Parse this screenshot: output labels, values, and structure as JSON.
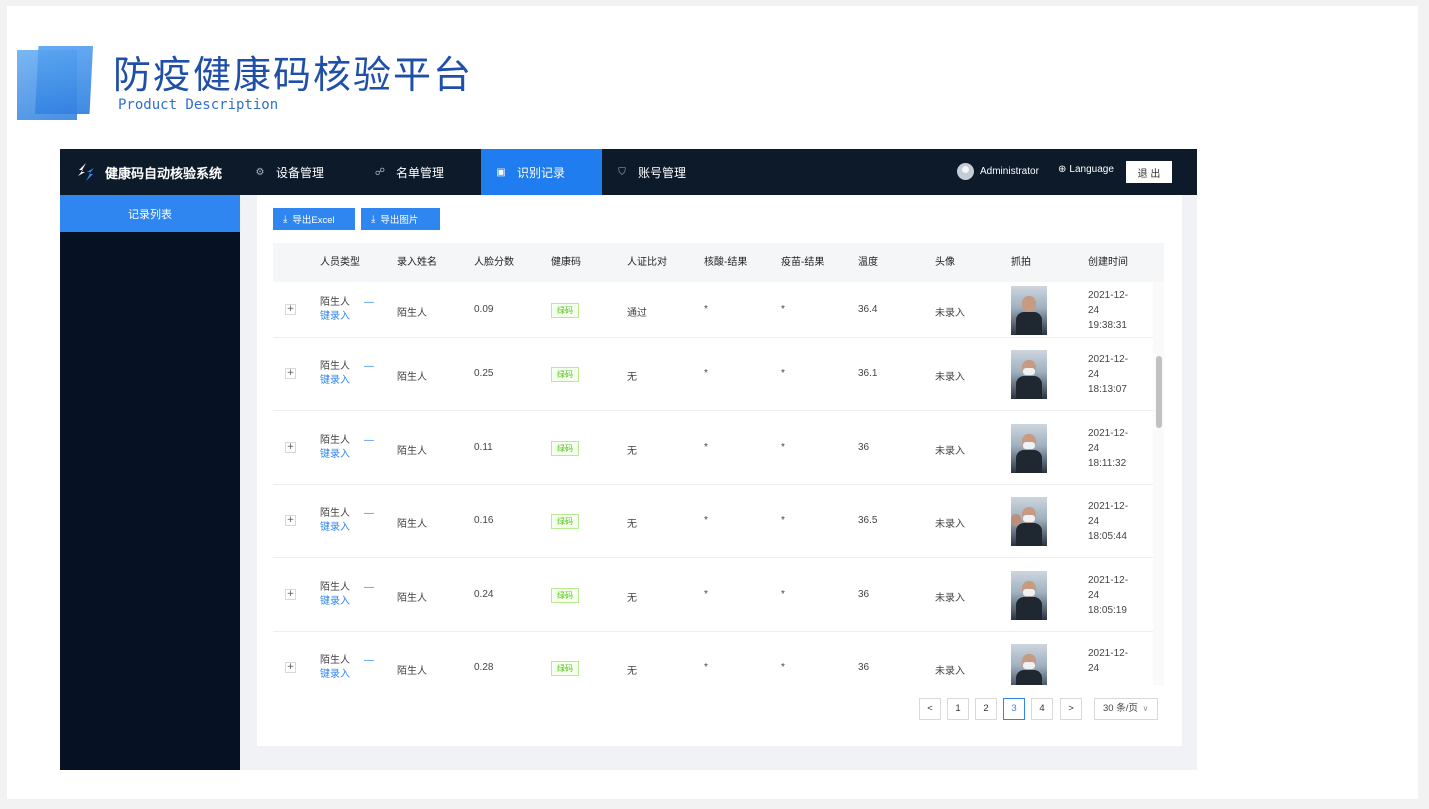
{
  "slide": {
    "title": "防疫健康码核验平台",
    "subtitle": "Product Description"
  },
  "app": {
    "brand": "健康码自动核验系统",
    "nav": [
      {
        "label": "设备管理",
        "icon": "gear-icon"
      },
      {
        "label": "名单管理",
        "icon": "people-icon"
      },
      {
        "label": "识别记录",
        "icon": "image-icon",
        "active": true
      },
      {
        "label": "账号管理",
        "icon": "shirt-icon"
      }
    ],
    "user": "Administrator",
    "language": "Language",
    "logout": "退 出",
    "sidebar": {
      "items": [
        {
          "label": "记录列表",
          "active": true
        }
      ]
    },
    "toolbar": {
      "export_excel": "导出Excel",
      "export_image": "导出图片"
    },
    "table": {
      "columns": [
        "人员类型",
        "录入姓名",
        "人脸分数",
        "健康码",
        "人证比对",
        "核酸-结果",
        "疫苗-结果",
        "温度",
        "头像",
        "抓拍",
        "创建时间"
      ],
      "rows": [
        {
          "type": "陌生人",
          "type_action": "键录入",
          "dash": "—",
          "name": "陌生人",
          "score": "0.09",
          "health_code": "绿码",
          "id_match": "通过",
          "nucleic": "*",
          "vaccine": "*",
          "temperature": "36.4",
          "avatar": "未录入",
          "date_line1": "2021-12-",
          "date_line2": "24",
          "date_line3": "19:38:31"
        },
        {
          "type": "陌生人",
          "type_action": "键录入",
          "dash": "—",
          "name": "陌生人",
          "score": "0.25",
          "health_code": "绿码",
          "id_match": "无",
          "nucleic": "*",
          "vaccine": "*",
          "temperature": "36.1",
          "avatar": "未录入",
          "date_line1": "2021-12-",
          "date_line2": "24",
          "date_line3": "18:13:07"
        },
        {
          "type": "陌生人",
          "type_action": "键录入",
          "dash": "—",
          "name": "陌生人",
          "score": "0.11",
          "health_code": "绿码",
          "id_match": "无",
          "nucleic": "*",
          "vaccine": "*",
          "temperature": "36",
          "avatar": "未录入",
          "date_line1": "2021-12-",
          "date_line2": "24",
          "date_line3": "18:11:32"
        },
        {
          "type": "陌生人",
          "type_action": "键录入",
          "dash": "—",
          "name": "陌生人",
          "score": "0.16",
          "health_code": "绿码",
          "id_match": "无",
          "nucleic": "*",
          "vaccine": "*",
          "temperature": "36.5",
          "avatar": "未录入",
          "date_line1": "2021-12-",
          "date_line2": "24",
          "date_line3": "18:05:44"
        },
        {
          "type": "陌生人",
          "type_action": "键录入",
          "dash": "—",
          "name": "陌生人",
          "score": "0.24",
          "health_code": "绿码",
          "id_match": "无",
          "nucleic": "*",
          "vaccine": "*",
          "temperature": "36",
          "avatar": "未录入",
          "date_line1": "2021-12-",
          "date_line2": "24",
          "date_line3": "18:05:19"
        },
        {
          "type": "陌生人",
          "type_action": "键录入",
          "dash": "—",
          "name": "陌生人",
          "score": "0.28",
          "health_code": "绿码",
          "id_match": "无",
          "nucleic": "*",
          "vaccine": "*",
          "temperature": "36",
          "avatar": "未录入",
          "date_line1": "2021-12-",
          "date_line2": "24",
          "date_line3": ""
        }
      ]
    },
    "pagination": {
      "prev": "<",
      "pages": [
        "1",
        "2",
        "3",
        "4"
      ],
      "current": "3",
      "next": ">",
      "page_size": "30 条/页"
    }
  },
  "colors": {
    "accent": "#2f86f1",
    "topbar": "#0d1a2a",
    "sidebar": "#061223",
    "tag_green": "#52c41a",
    "title_blue": "#1f4fa8"
  }
}
